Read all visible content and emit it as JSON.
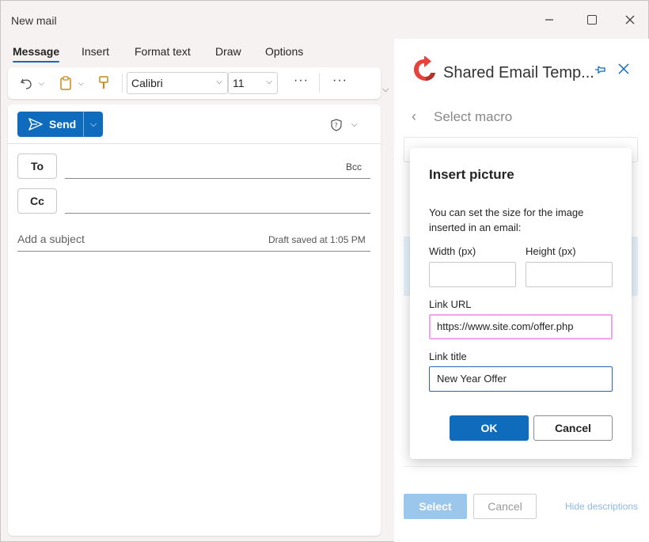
{
  "window": {
    "title": "New mail"
  },
  "tabs": [
    "Message",
    "Insert",
    "Format text",
    "Draw",
    "Options"
  ],
  "toolbar": {
    "font": "Calibri",
    "size": "11"
  },
  "compose": {
    "send_label": "Send",
    "to_label": "To",
    "cc_label": "Cc",
    "bcc_label": "Bcc",
    "subject_placeholder": "Add a subject",
    "draft_status": "Draft saved at 1:05 PM"
  },
  "pane": {
    "title": "Shared Email Temp...",
    "back_label": "Select macro",
    "select_label": "Select",
    "cancel_label": "Cancel",
    "hide_label": "Hide descriptions"
  },
  "dialog": {
    "title": "Insert picture",
    "description": "You can set the size for the image inserted in an email:",
    "width_label": "Width (px)",
    "height_label": "Height (px)",
    "width_value": "",
    "height_value": "",
    "url_label": "Link URL",
    "url_value": "https://www.site.com/offer.php",
    "link_title_label": "Link title",
    "link_title_value": "New Year Offer",
    "ok_label": "OK",
    "cancel_label": "Cancel"
  },
  "colors": {
    "accent": "#0f6cbd",
    "highlight": "#f3a2ef",
    "logo": "#e8413c"
  }
}
